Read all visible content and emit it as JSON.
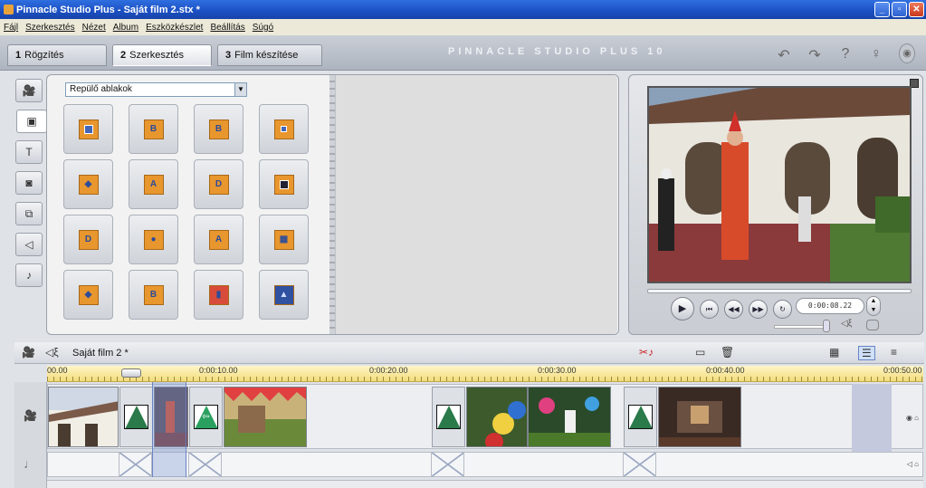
{
  "window": {
    "title": "Pinnacle Studio Plus - Saját film 2.stx *"
  },
  "menu": [
    "Fájl",
    "Szerkesztés",
    "Nézet",
    "Album",
    "Eszközkészlet",
    "Beállítás",
    "Súgó"
  ],
  "tabs": [
    {
      "num": "1",
      "label": "Rögzítés"
    },
    {
      "num": "2",
      "label": "Szerkesztés"
    },
    {
      "num": "3",
      "label": "Film készítése"
    }
  ],
  "brand": "PINNACLE STUDIO PLUS 10",
  "album": {
    "dropdown": "Repülő ablakok",
    "transition_icons": [
      "square",
      "letter-b",
      "letter-b",
      "square",
      "diamond",
      "letter-a",
      "letter-d",
      "square-dark",
      "letter-d",
      "circle",
      "letter-a",
      "pattern",
      "diamond",
      "letter-b",
      "red",
      "blue"
    ]
  },
  "player": {
    "timecode": "0:00:08.22"
  },
  "timeline": {
    "project_title": "Saját film 2 *",
    "ruler": [
      "00.00",
      "0:00:10.00",
      "0:00:20.00",
      "0:00:30.00",
      "0:00:40.00",
      "0:00:50.00"
    ]
  },
  "colors": {
    "accent": "#e8962e",
    "ruler": "#f2dc7a",
    "titlebar": "#1b4fc2"
  }
}
